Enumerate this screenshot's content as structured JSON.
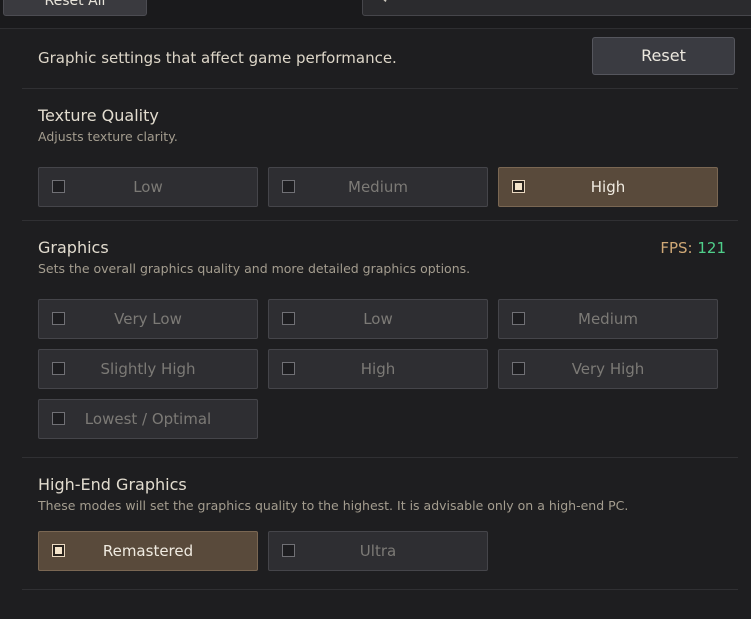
{
  "top": {
    "reset_all_label": "Reset All",
    "search_icon": "search-icon"
  },
  "header": {
    "description": "Graphic settings that affect game performance.",
    "reset_label": "Reset"
  },
  "texture": {
    "title": "Texture Quality",
    "subtitle": "Adjusts texture clarity.",
    "options": [
      {
        "label": "Low",
        "selected": false
      },
      {
        "label": "Medium",
        "selected": false
      },
      {
        "label": "High",
        "selected": true
      }
    ]
  },
  "graphics": {
    "title": "Graphics",
    "subtitle": "Sets the overall graphics quality and more detailed graphics options.",
    "fps_label": "FPS:",
    "fps_value": "121",
    "options": [
      {
        "label": "Very Low",
        "selected": false
      },
      {
        "label": "Low",
        "selected": false
      },
      {
        "label": "Medium",
        "selected": false
      },
      {
        "label": "Slightly High",
        "selected": false
      },
      {
        "label": "High",
        "selected": false
      },
      {
        "label": "Very High",
        "selected": false
      },
      {
        "label": "Lowest / Optimal",
        "selected": false
      }
    ]
  },
  "highend": {
    "title": "High-End Graphics",
    "subtitle": "These modes will set the graphics quality to the highest. It is advisable only on a high-end PC.",
    "options": [
      {
        "label": "Remastered",
        "selected": true
      },
      {
        "label": "Ultra",
        "selected": false
      }
    ]
  },
  "colors": {
    "accent_selected": "#594a3b",
    "fps_value": "#4fd08b",
    "fps_label": "#cfa876"
  }
}
